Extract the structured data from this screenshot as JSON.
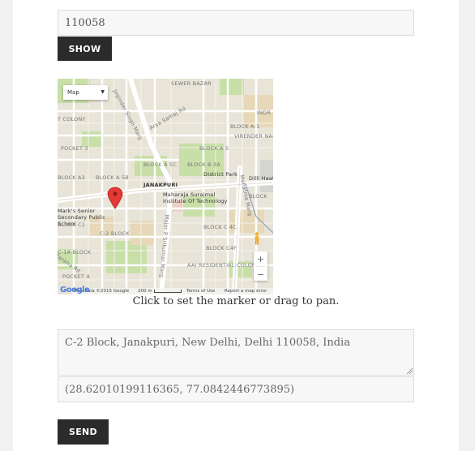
{
  "search": {
    "zip_value": "110058",
    "show_label": "SHOW"
  },
  "map": {
    "type_label": "Map",
    "labels": {
      "sewer_bazar": "SEWER BAZAR",
      "indra": "INDR",
      "colony": "T COLONY",
      "block_a1": "BLOCK A-1",
      "virender_nagar": "VIRENDER NAGAR",
      "joginder_singh_marg": "Joginder Singh Marg",
      "arya_samaj_rd": "Arya Samaj Rd",
      "pocket_3": "POCKET 3",
      "block_a5": "BLOCK A 5",
      "block_a3": "BLOCK A3",
      "block_a5b": "BLOCK A 5B",
      "block_a5c": "BLOCK A 5C",
      "block_b3a": "BLOCK B 3A",
      "district_park": "District Park",
      "dilli_haat": "Dilli Haat",
      "janakpuri": "JANAKPURI",
      "school": "Mark's Senior Secondary Public School",
      "institute": "Maharaja Surajmal Institute Of Technology",
      "block": "BLOCK",
      "block_c1": "BLOCK C1",
      "c2_block": "C-2 BLOCK",
      "block_c4c": "BLOCK C 4C",
      "block_c4f": "BLOCK C4F",
      "c1a_block": "C-1A BLOCK",
      "aai_residential": "AAI RESIDENTIAL COLONY",
      "pocket_4": "POCKET 4",
      "harsh_rd": "Harsh Rd",
      "pankha_rd": "Pankha Rd",
      "major_srikumar": "Major P Srikumar Marg",
      "mahatma_marg": "Mahatma Marg"
    },
    "attribution": "Map data ©2015 Google",
    "scale": "200 m",
    "terms": "Terms of Use",
    "report": "Report a map error",
    "logo": "Google",
    "zoom_in": "+",
    "zoom_out": "−"
  },
  "hint_text": "Click to set the marker or drag to pan.",
  "address": {
    "value": "C-2 Block, Janakpuri, New Delhi, Delhi 110058, India"
  },
  "coordinates": {
    "value": "(28.62010199116365, 77.0842446773895)"
  },
  "send_label": "SEND"
}
